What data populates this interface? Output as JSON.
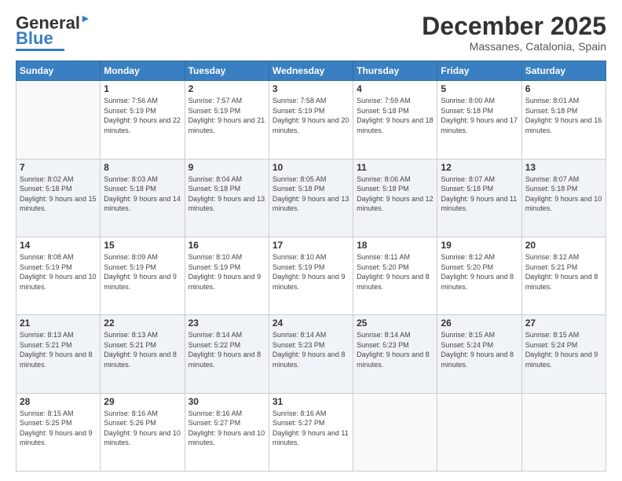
{
  "logo": {
    "text1": "General",
    "text2": "Blue"
  },
  "title": "December 2025",
  "location": "Massanes, Catalonia, Spain",
  "weekdays": [
    "Sunday",
    "Monday",
    "Tuesday",
    "Wednesday",
    "Thursday",
    "Friday",
    "Saturday"
  ],
  "weeks": [
    [
      {
        "day": "",
        "sunrise": "",
        "sunset": "",
        "daylight": ""
      },
      {
        "day": "1",
        "sunrise": "Sunrise: 7:56 AM",
        "sunset": "Sunset: 5:19 PM",
        "daylight": "Daylight: 9 hours and 22 minutes."
      },
      {
        "day": "2",
        "sunrise": "Sunrise: 7:57 AM",
        "sunset": "Sunset: 5:19 PM",
        "daylight": "Daylight: 9 hours and 21 minutes."
      },
      {
        "day": "3",
        "sunrise": "Sunrise: 7:58 AM",
        "sunset": "Sunset: 5:19 PM",
        "daylight": "Daylight: 9 hours and 20 minutes."
      },
      {
        "day": "4",
        "sunrise": "Sunrise: 7:59 AM",
        "sunset": "Sunset: 5:18 PM",
        "daylight": "Daylight: 9 hours and 18 minutes."
      },
      {
        "day": "5",
        "sunrise": "Sunrise: 8:00 AM",
        "sunset": "Sunset: 5:18 PM",
        "daylight": "Daylight: 9 hours and 17 minutes."
      },
      {
        "day": "6",
        "sunrise": "Sunrise: 8:01 AM",
        "sunset": "Sunset: 5:18 PM",
        "daylight": "Daylight: 9 hours and 16 minutes."
      }
    ],
    [
      {
        "day": "7",
        "sunrise": "Sunrise: 8:02 AM",
        "sunset": "Sunset: 5:18 PM",
        "daylight": "Daylight: 9 hours and 15 minutes."
      },
      {
        "day": "8",
        "sunrise": "Sunrise: 8:03 AM",
        "sunset": "Sunset: 5:18 PM",
        "daylight": "Daylight: 9 hours and 14 minutes."
      },
      {
        "day": "9",
        "sunrise": "Sunrise: 8:04 AM",
        "sunset": "Sunset: 5:18 PM",
        "daylight": "Daylight: 9 hours and 13 minutes."
      },
      {
        "day": "10",
        "sunrise": "Sunrise: 8:05 AM",
        "sunset": "Sunset: 5:18 PM",
        "daylight": "Daylight: 9 hours and 13 minutes."
      },
      {
        "day": "11",
        "sunrise": "Sunrise: 8:06 AM",
        "sunset": "Sunset: 5:18 PM",
        "daylight": "Daylight: 9 hours and 12 minutes."
      },
      {
        "day": "12",
        "sunrise": "Sunrise: 8:07 AM",
        "sunset": "Sunset: 5:18 PM",
        "daylight": "Daylight: 9 hours and 11 minutes."
      },
      {
        "day": "13",
        "sunrise": "Sunrise: 8:07 AM",
        "sunset": "Sunset: 5:18 PM",
        "daylight": "Daylight: 9 hours and 10 minutes."
      }
    ],
    [
      {
        "day": "14",
        "sunrise": "Sunrise: 8:08 AM",
        "sunset": "Sunset: 5:19 PM",
        "daylight": "Daylight: 9 hours and 10 minutes."
      },
      {
        "day": "15",
        "sunrise": "Sunrise: 8:09 AM",
        "sunset": "Sunset: 5:19 PM",
        "daylight": "Daylight: 9 hours and 9 minutes."
      },
      {
        "day": "16",
        "sunrise": "Sunrise: 8:10 AM",
        "sunset": "Sunset: 5:19 PM",
        "daylight": "Daylight: 9 hours and 9 minutes."
      },
      {
        "day": "17",
        "sunrise": "Sunrise: 8:10 AM",
        "sunset": "Sunset: 5:19 PM",
        "daylight": "Daylight: 9 hours and 9 minutes."
      },
      {
        "day": "18",
        "sunrise": "Sunrise: 8:11 AM",
        "sunset": "Sunset: 5:20 PM",
        "daylight": "Daylight: 9 hours and 8 minutes."
      },
      {
        "day": "19",
        "sunrise": "Sunrise: 8:12 AM",
        "sunset": "Sunset: 5:20 PM",
        "daylight": "Daylight: 9 hours and 8 minutes."
      },
      {
        "day": "20",
        "sunrise": "Sunrise: 8:12 AM",
        "sunset": "Sunset: 5:21 PM",
        "daylight": "Daylight: 9 hours and 8 minutes."
      }
    ],
    [
      {
        "day": "21",
        "sunrise": "Sunrise: 8:13 AM",
        "sunset": "Sunset: 5:21 PM",
        "daylight": "Daylight: 9 hours and 8 minutes."
      },
      {
        "day": "22",
        "sunrise": "Sunrise: 8:13 AM",
        "sunset": "Sunset: 5:21 PM",
        "daylight": "Daylight: 9 hours and 8 minutes."
      },
      {
        "day": "23",
        "sunrise": "Sunrise: 8:14 AM",
        "sunset": "Sunset: 5:22 PM",
        "daylight": "Daylight: 9 hours and 8 minutes."
      },
      {
        "day": "24",
        "sunrise": "Sunrise: 8:14 AM",
        "sunset": "Sunset: 5:23 PM",
        "daylight": "Daylight: 9 hours and 8 minutes."
      },
      {
        "day": "25",
        "sunrise": "Sunrise: 8:14 AM",
        "sunset": "Sunset: 5:23 PM",
        "daylight": "Daylight: 9 hours and 8 minutes."
      },
      {
        "day": "26",
        "sunrise": "Sunrise: 8:15 AM",
        "sunset": "Sunset: 5:24 PM",
        "daylight": "Daylight: 9 hours and 8 minutes."
      },
      {
        "day": "27",
        "sunrise": "Sunrise: 8:15 AM",
        "sunset": "Sunset: 5:24 PM",
        "daylight": "Daylight: 9 hours and 9 minutes."
      }
    ],
    [
      {
        "day": "28",
        "sunrise": "Sunrise: 8:15 AM",
        "sunset": "Sunset: 5:25 PM",
        "daylight": "Daylight: 9 hours and 9 minutes."
      },
      {
        "day": "29",
        "sunrise": "Sunrise: 8:16 AM",
        "sunset": "Sunset: 5:26 PM",
        "daylight": "Daylight: 9 hours and 10 minutes."
      },
      {
        "day": "30",
        "sunrise": "Sunrise: 8:16 AM",
        "sunset": "Sunset: 5:27 PM",
        "daylight": "Daylight: 9 hours and 10 minutes."
      },
      {
        "day": "31",
        "sunrise": "Sunrise: 8:16 AM",
        "sunset": "Sunset: 5:27 PM",
        "daylight": "Daylight: 9 hours and 11 minutes."
      },
      {
        "day": "",
        "sunrise": "",
        "sunset": "",
        "daylight": ""
      },
      {
        "day": "",
        "sunrise": "",
        "sunset": "",
        "daylight": ""
      },
      {
        "day": "",
        "sunrise": "",
        "sunset": "",
        "daylight": ""
      }
    ]
  ]
}
